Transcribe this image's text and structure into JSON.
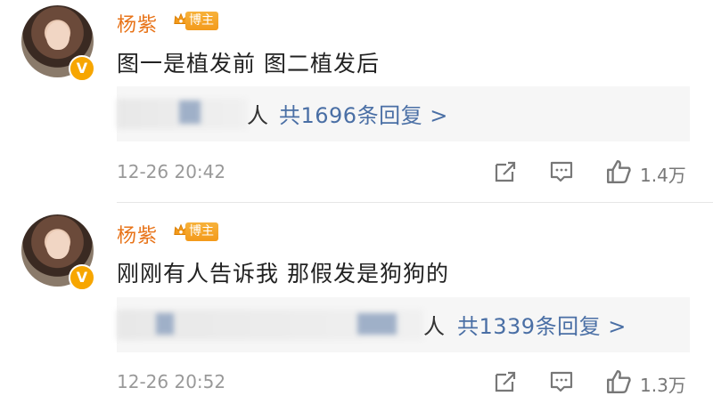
{
  "comments": [
    {
      "author": "杨紫",
      "badge": "博主",
      "text": "图一是植发前 图二植发后",
      "reply_suffix": "人",
      "reply_link": "共1696条回复 >",
      "time": "12-26 20:42",
      "likes": "1.4万"
    },
    {
      "author": "杨紫",
      "badge": "博主",
      "text": "刚刚有人告诉我 那假发是狗狗的",
      "reply_suffix": "人",
      "reply_link": "共1339条回复 >",
      "time": "12-26 20:52",
      "likes": "1.3万"
    }
  ],
  "colors": {
    "author": "#e8741a",
    "link": "#4a6fa5",
    "badge": "#f39a1b",
    "meta": "#999999"
  },
  "icons": [
    "verified-badge-icon",
    "crown-icon",
    "share-icon",
    "comment-icon",
    "like-icon"
  ]
}
